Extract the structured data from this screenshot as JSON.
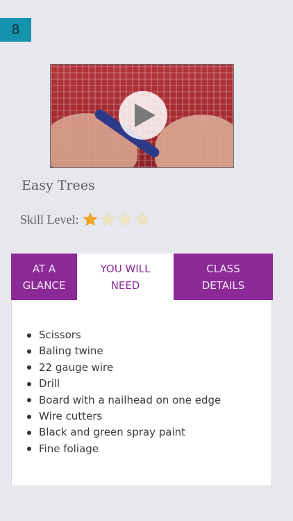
{
  "badge": {
    "number": "8"
  },
  "video": {
    "play_icon": "play-icon"
  },
  "class": {
    "title": "Easy Trees",
    "skill_label": "Skill Level:",
    "skill_rating": 1,
    "skill_max": 4
  },
  "tabs": [
    {
      "label": "AT A GLANCE",
      "active": false
    },
    {
      "label": "YOU WILL NEED",
      "active": true
    },
    {
      "label": "CLASS DETAILS",
      "active": false
    }
  ],
  "supplies": [
    "Scissors",
    "Baling twine",
    "22 gauge wire",
    "Drill",
    "Board with a nailhead on one edge",
    "Wire cutters",
    "Black and green spray paint",
    "Fine foliage"
  ],
  "colors": {
    "accent_purple": "#8b2a97",
    "badge_teal": "#1593ad",
    "star_filled": "#f2a81d",
    "star_empty": "#efe3c2"
  }
}
